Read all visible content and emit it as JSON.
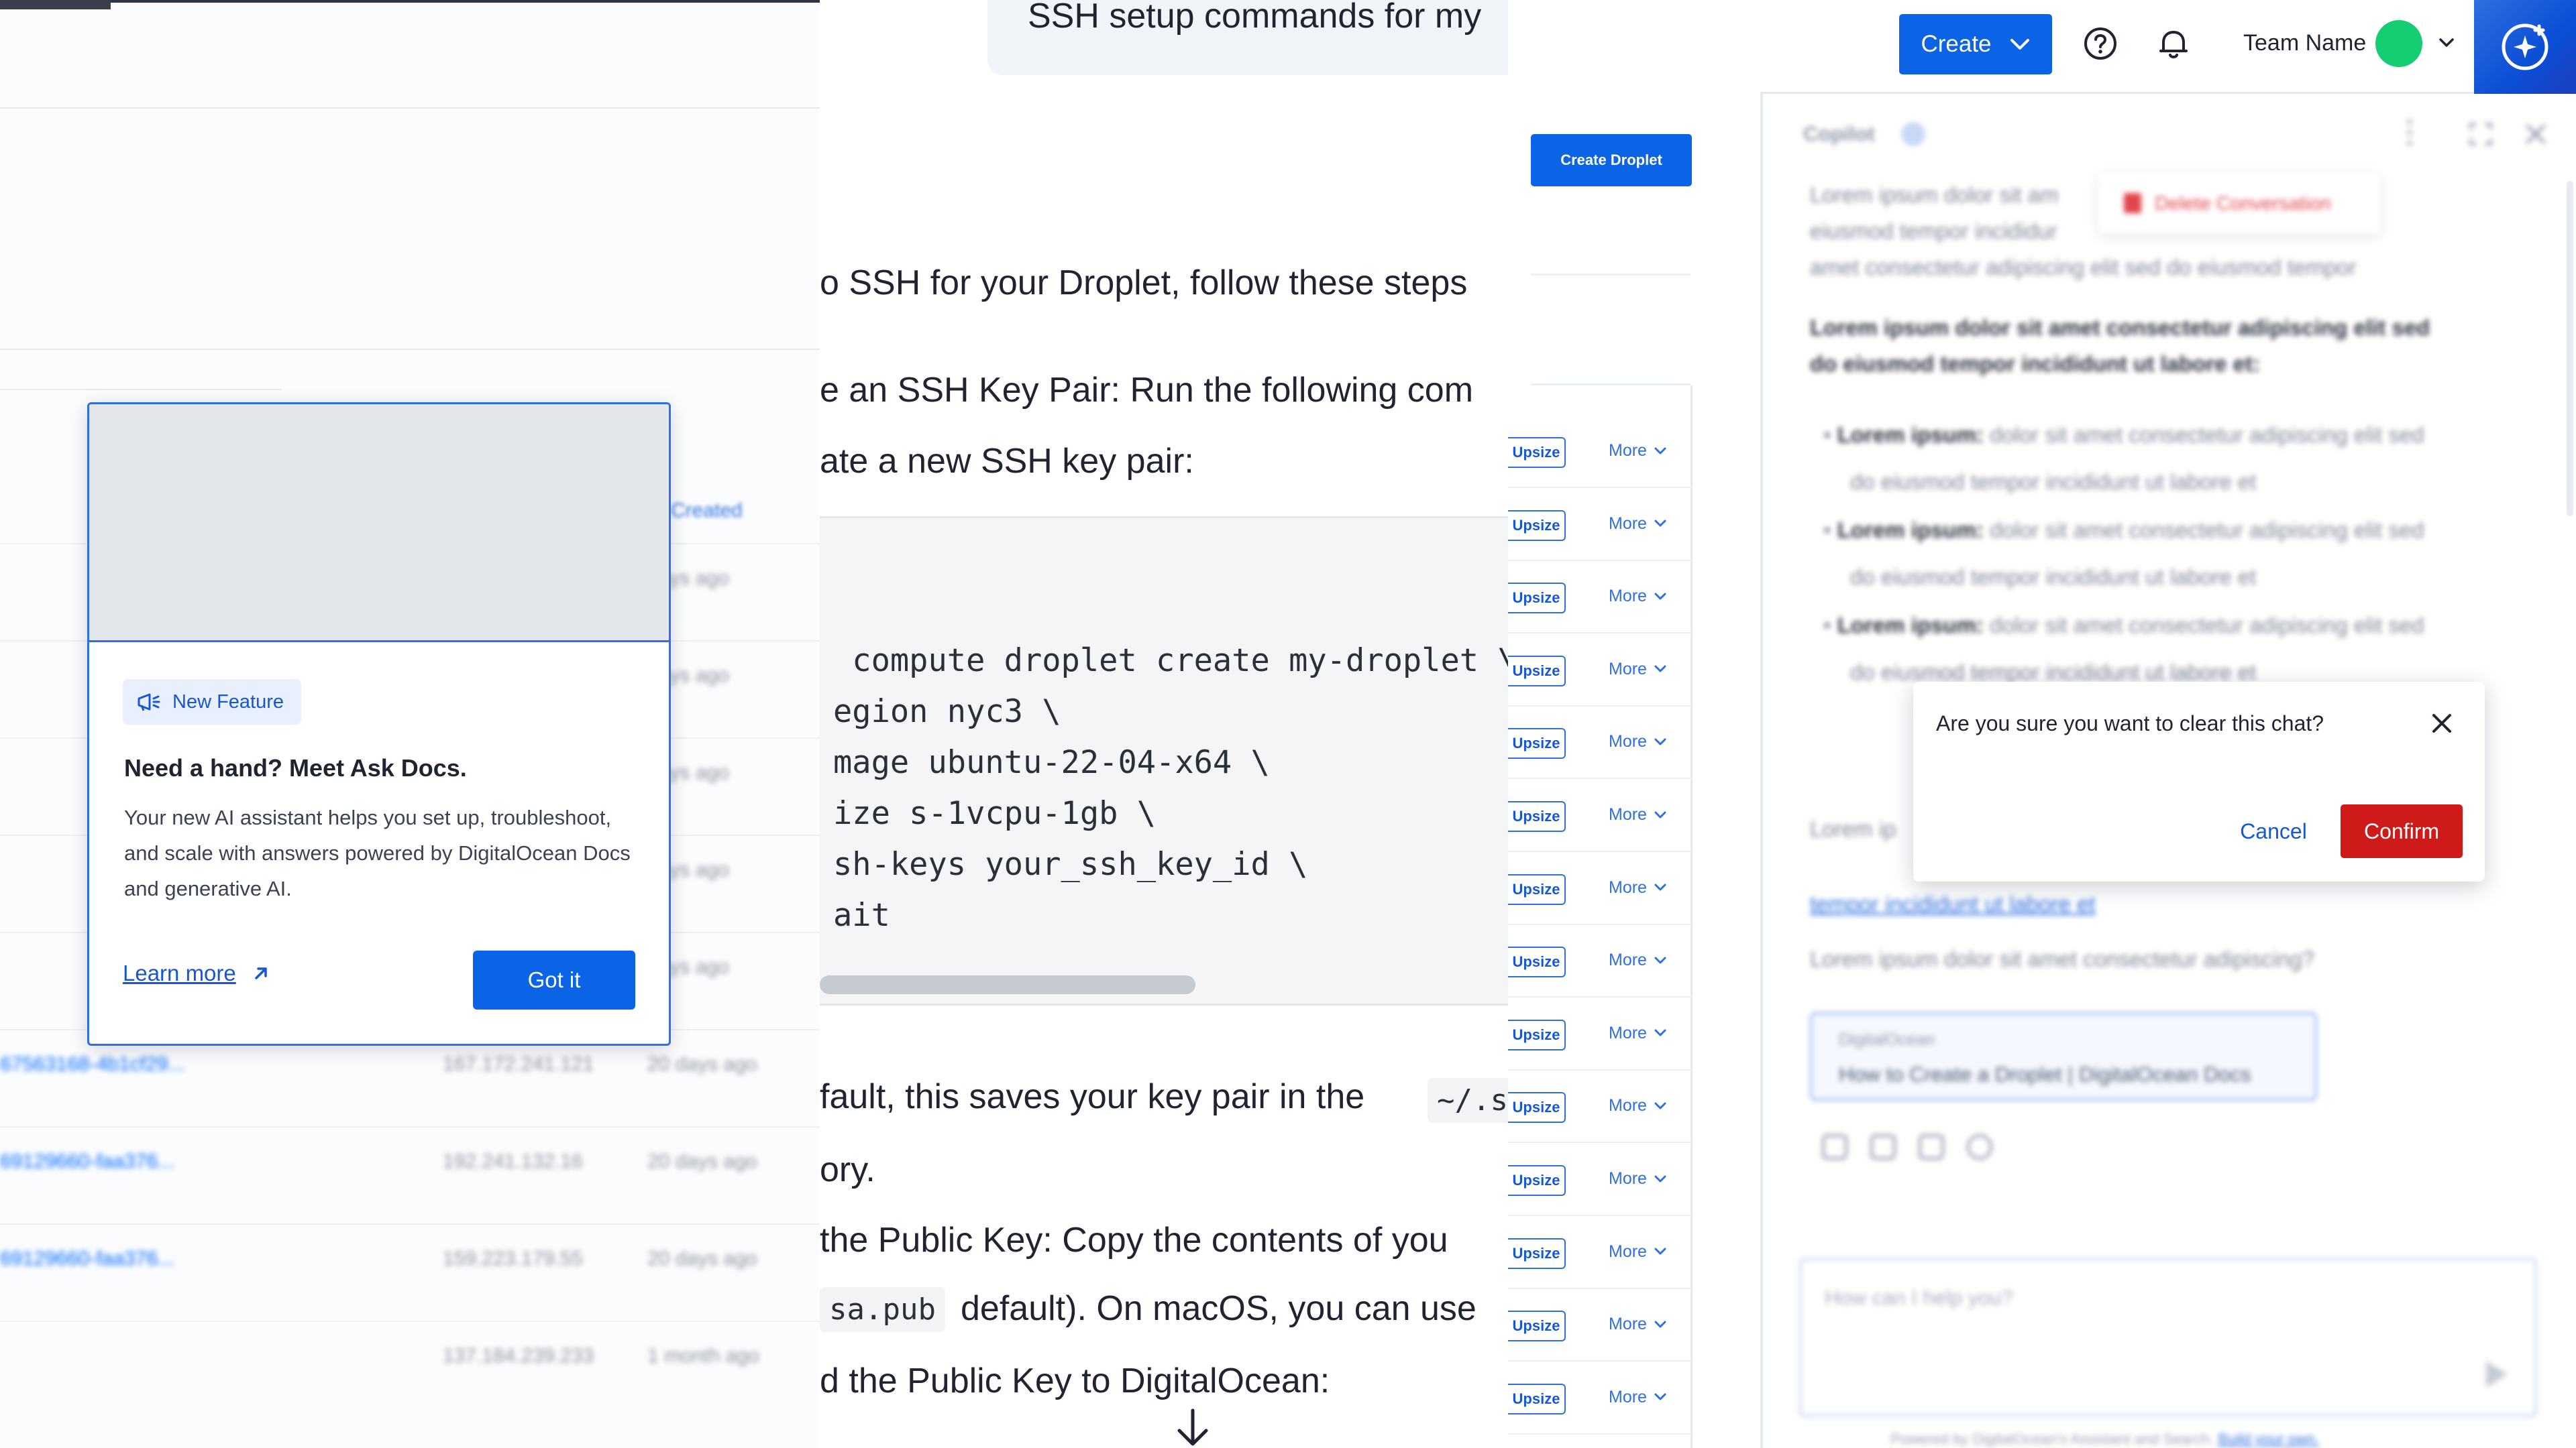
{
  "popover": {
    "badge": "New Feature",
    "title": "Need a hand? Meet Ask Docs.",
    "description": "Your new AI assistant helps you set up, troubleshoot, and scale with answers powered by DigitalOcean Docs and generative AI.",
    "learn_more": "Learn more",
    "got_it": "Got it"
  },
  "docs": {
    "chat_bubble": "SSH setup commands for my",
    "p1": "o SSH for your Droplet, follow these steps",
    "p2": "e an SSH Key Pair: Run the following com",
    "p3": "ate a new SSH key pair:",
    "code": [
      " compute droplet create my-droplet \\",
      "egion nyc3 \\",
      "mage ubuntu-22-04-x64 \\",
      "ize s-1vcpu-1gb \\",
      "sh-keys your_ssh_key_id \\",
      "ait"
    ],
    "p4": "fault, this saves your key pair in the",
    "p4_code": "~/.s",
    "p5": "ory.",
    "p6": " the Public Key: Copy the contents of you",
    "p7_code": "sa.pub",
    "p7": "default). On macOS, you can use",
    "p8": "d the Public Key to DigitalOcean:"
  },
  "droplets": {
    "create_droplet": "Create Droplet",
    "header_created": "Created",
    "upsize_label": "Upsize",
    "more_label": "More",
    "rows": [
      {
        "name": "",
        "ip": "",
        "age": "days ago"
      },
      {
        "name": "",
        "ip": "",
        "age": "days ago"
      },
      {
        "name": "",
        "ip": "",
        "age": "days ago"
      },
      {
        "name": "",
        "ip": "",
        "age": "days ago"
      },
      {
        "name": "",
        "ip": "",
        "age": "days ago"
      },
      {
        "name": "67563168-4b1cf29...",
        "ip": "167.172.241.121",
        "age": "20 days ago"
      },
      {
        "name": "69129660-faa376...",
        "ip": "192.241.132.16",
        "age": "20 days ago"
      },
      {
        "name": "69129660-faa376...",
        "ip": "159.223.179.55",
        "age": "20 days ago"
      },
      {
        "name": "",
        "ip": "137.184.239.233",
        "age": "1 month ago"
      }
    ]
  },
  "topnav": {
    "create": "Create",
    "team_name": "Team Name"
  },
  "copilot": {
    "title": "Copilot",
    "menu_delete": "Delete Conversation",
    "lines": [
      "Lorem ipsum dolor sit am",
      "eiusmod tempor incididur",
      "amet consectetur adipiscing elit sed do eiusmod tempor"
    ],
    "bold1": "Lorem ipsum dolor sit amet consectetur adipiscing elit sed",
    "bold2": "do eiusmod tempor incididunt ut labore et:",
    "bullets": [
      {
        "lead": "Lorem ipsum:",
        "text": " dolor sit amet consectetur adipiscing elit sed"
      },
      {
        "lead": "Lorem ipsum:",
        "text": " dolor sit amet consectetur adipiscing elit sed"
      },
      {
        "lead": "Lorem ipsum:",
        "text": " dolor sit amet consectetur adipiscing elit sed"
      }
    ],
    "bullet_cont": "do eiusmod tempor incididunt ut labore et",
    "para_tail": "Lorem ip",
    "link": "tempor incididunt ut labore et",
    "question": "Lorem ipsum dolor sit amet consectetur adipiscing?",
    "card_source": "DigitalOcean",
    "card_title": "How to Create a Droplet | DigitalOcean Docs",
    "input_placeholder": "How can I help you?",
    "footer": "Powered by DigitalOcean's Assistant and Search.",
    "footer_link": "Build your own."
  },
  "dialog": {
    "question": "Are you sure you want to clear this chat?",
    "cancel": "Cancel",
    "confirm": "Confirm"
  },
  "colors": {
    "primary": "#0b63e5",
    "danger": "#cf1a1a",
    "avatar": "#15cd72"
  }
}
